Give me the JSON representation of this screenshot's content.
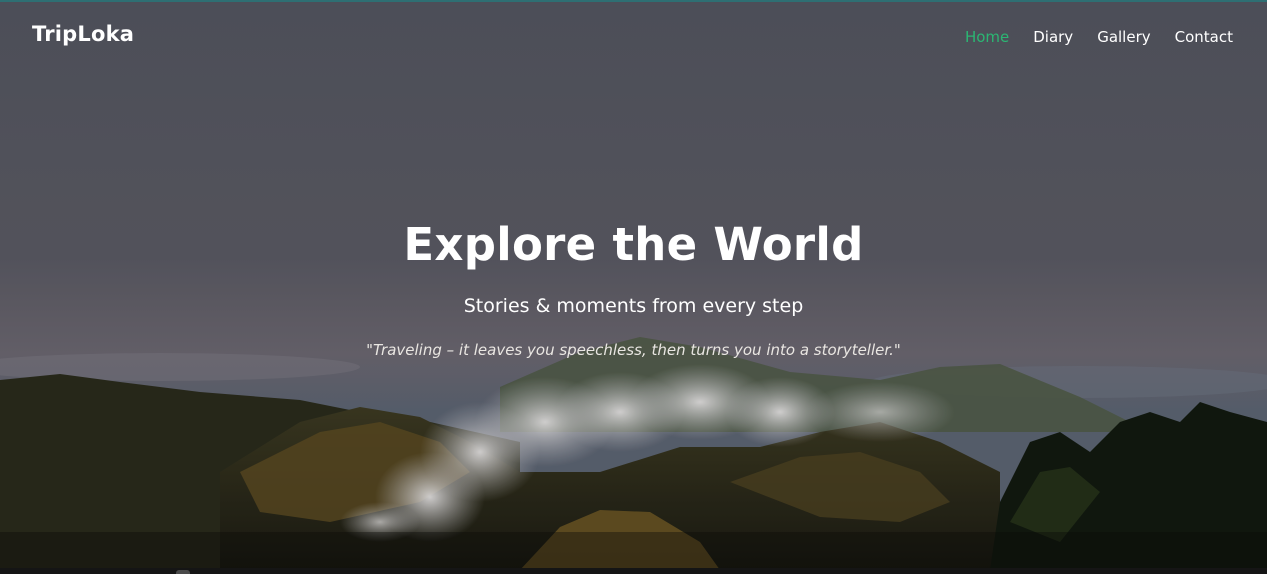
{
  "brand": {
    "name": "TripLoka"
  },
  "nav": {
    "items": [
      {
        "label": "Home",
        "active": true
      },
      {
        "label": "Diary",
        "active": false
      },
      {
        "label": "Gallery",
        "active": false
      },
      {
        "label": "Contact",
        "active": false
      }
    ]
  },
  "hero": {
    "title": "Explore the World",
    "subtitle": "Stories & moments from every step",
    "quote": "\"Traveling – it leaves you speechless, then turns you into a storyteller.\""
  },
  "colors": {
    "accent": "#2bb673",
    "text": "#ffffff",
    "sky": "#545660"
  }
}
